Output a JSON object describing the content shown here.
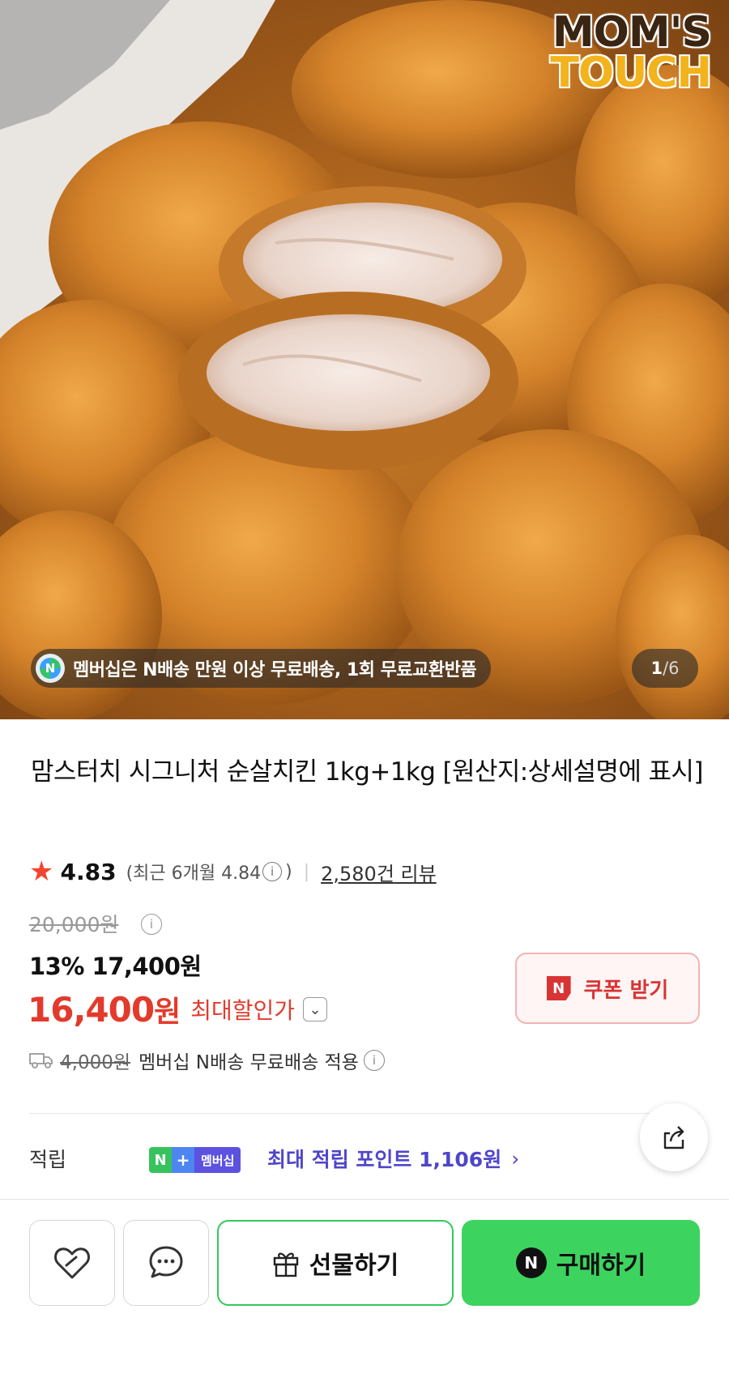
{
  "hero": {
    "logo_line1": "MOM'S",
    "logo_line2": "TOUCH",
    "banner_text": "멤버십은 N배송 만원 이상 무료배송, 1회 무료교환반품",
    "banner_badge": "N",
    "counter_current": "1",
    "counter_total": "/6"
  },
  "product": {
    "title": "맘스터치 시그니처 순살치킨 1kg+1kg [원산지:상세설명에 표시]",
    "rating_score": "4.83",
    "recent_rating": "(최근 6개월 4.84",
    "recent_close": ")",
    "review_count": "2,580건 리뷰",
    "original_price": "20,000원",
    "discount_line": "13% 17,400원",
    "final_price_number": "16,400",
    "final_price_unit": "원",
    "final_price_label": "최대할인가",
    "coupon_label": "쿠폰 받기",
    "coupon_badge": "N",
    "shipping_old_fee": "4,000원",
    "shipping_text": "멤버십 N배송 무료배송 적용"
  },
  "points": {
    "label": "적립",
    "badge_n": "N",
    "badge_plus": "+",
    "badge_member": "멤버십",
    "text": "최대 적립 포인트 1,106원"
  },
  "bottom_bar": {
    "gift_label": "선물하기",
    "buy_label": "구매하기",
    "buy_badge": "N"
  },
  "colors": {
    "accent_red": "#e23b2c",
    "naver_green": "#3dd35f",
    "points_purple": "#4f46c9"
  },
  "icons": {
    "like": "heart-link-icon",
    "talk": "chat-bubble-icon",
    "gift": "gift-box-icon",
    "share": "share-icon",
    "star": "star-icon",
    "truck": "truck-icon",
    "info": "info-icon",
    "dropdown": "chevron-down-icon"
  }
}
